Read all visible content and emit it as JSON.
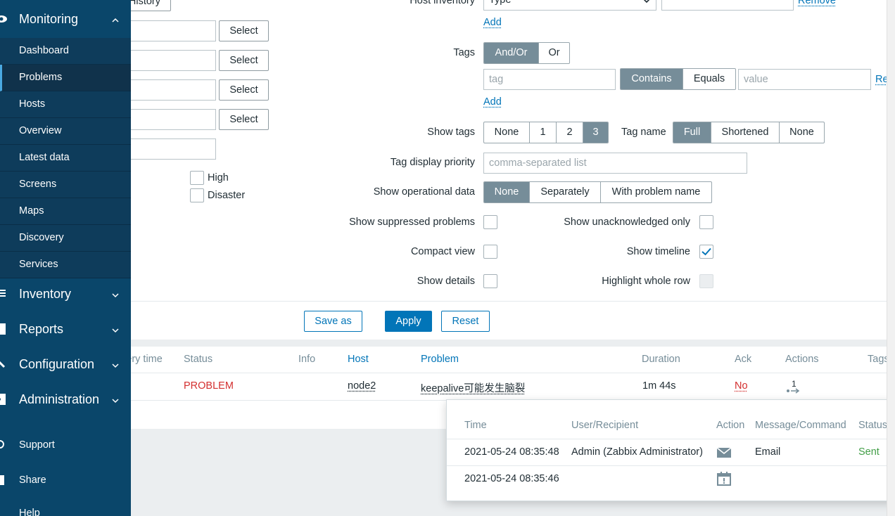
{
  "sidebar": {
    "monitoring": "Monitoring",
    "items": [
      "Dashboard",
      "Problems",
      "Hosts",
      "Overview",
      "Latest data",
      "Screens",
      "Maps",
      "Discovery",
      "Services"
    ],
    "sections": [
      "Inventory",
      "Reports",
      "Configuration",
      "Administration"
    ],
    "footer": [
      "Support",
      "Share",
      "Help"
    ]
  },
  "filter": {
    "history_btn": "History",
    "select": "Select",
    "severity": [
      "High",
      "Disaster"
    ],
    "host_inventory_label": "Host inventory",
    "host_inventory_type": "Type",
    "remove": "Remove",
    "add": "Add",
    "tags_label": "Tags",
    "tags_operator": [
      "And/Or",
      "Or"
    ],
    "tag_placeholder": "tag",
    "tag_operator": [
      "Contains",
      "Equals"
    ],
    "value_placeholder": "value",
    "remove_short": "Re",
    "show_tags_label": "Show tags",
    "show_tags": [
      "None",
      "1",
      "2",
      "3"
    ],
    "tag_name_label": "Tag name",
    "tag_name": [
      "Full",
      "Shortened",
      "None"
    ],
    "tag_priority_label": "Tag display priority",
    "tag_priority_placeholder": "comma-separated list",
    "opdata_label": "Show operational data",
    "opdata": [
      "None",
      "Separately",
      "With problem name"
    ],
    "suppressed_label": "Show suppressed problems",
    "unack_label": "Show unacknowledged only",
    "compact_label": "Compact view",
    "timeline_label": "Show timeline",
    "details_label": "Show details",
    "highlight_label": "Highlight whole row",
    "save_as": "Save as",
    "apply": "Apply",
    "reset": "Reset"
  },
  "table": {
    "headers": [
      "very time",
      "Status",
      "Info",
      "Host",
      "Problem",
      "Duration",
      "Ack",
      "Actions",
      "Tags"
    ],
    "row": {
      "status": "PROBLEM",
      "host": "node2",
      "problem": "keepalive可能发生脑裂",
      "duration": "1m 44s",
      "ack": "No",
      "actions_count": "1"
    }
  },
  "popup": {
    "headers": [
      "Time",
      "User/Recipient",
      "Action",
      "Message/Command",
      "Status"
    ],
    "rows": [
      {
        "time": "2021-05-24 08:35:48",
        "user": "Admin (Zabbix Administrator)",
        "action_icon": "envelope-icon",
        "message": "Email",
        "status": "Sent"
      },
      {
        "time": "2021-05-24 08:35:46",
        "user": "",
        "action_icon": "calendar-alert-icon",
        "message": "",
        "status": ""
      }
    ]
  },
  "colors": {
    "sidebar_bg": "#0a466a",
    "accent": "#0275b8",
    "problem": "#d32f2f",
    "sent": "#429e47",
    "toggle_on": "#768d99"
  }
}
